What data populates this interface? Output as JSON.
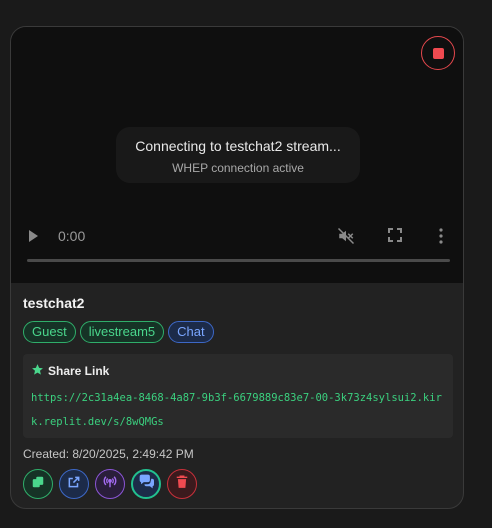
{
  "video": {
    "status_title": "Connecting to testchat2 stream...",
    "status_subtitle": "WHEP connection active",
    "time": "0:00"
  },
  "stream": {
    "name": "testchat2",
    "tags": [
      "Guest",
      "livestream5",
      "Chat"
    ]
  },
  "share": {
    "title": "Share Link",
    "url": "https://2c31a4ea-8468-4a87-9b3f-6679889c83e7-00-3k73z4sylsui2.kirk.replit.dev/s/8wQMGs"
  },
  "created": "Created: 8/20/2025, 2:49:42 PM",
  "colors": {
    "green": "#4ad68c",
    "blue": "#7aa6ff",
    "purple": "#a36bf0",
    "red": "#f04a50"
  },
  "icons": [
    "stop-icon",
    "play-icon",
    "mute-icon",
    "fullscreen-icon",
    "more-icon",
    "star-icon",
    "copy-icon",
    "external-link-icon",
    "radio-tower-icon",
    "chat-icon",
    "trash-icon"
  ]
}
